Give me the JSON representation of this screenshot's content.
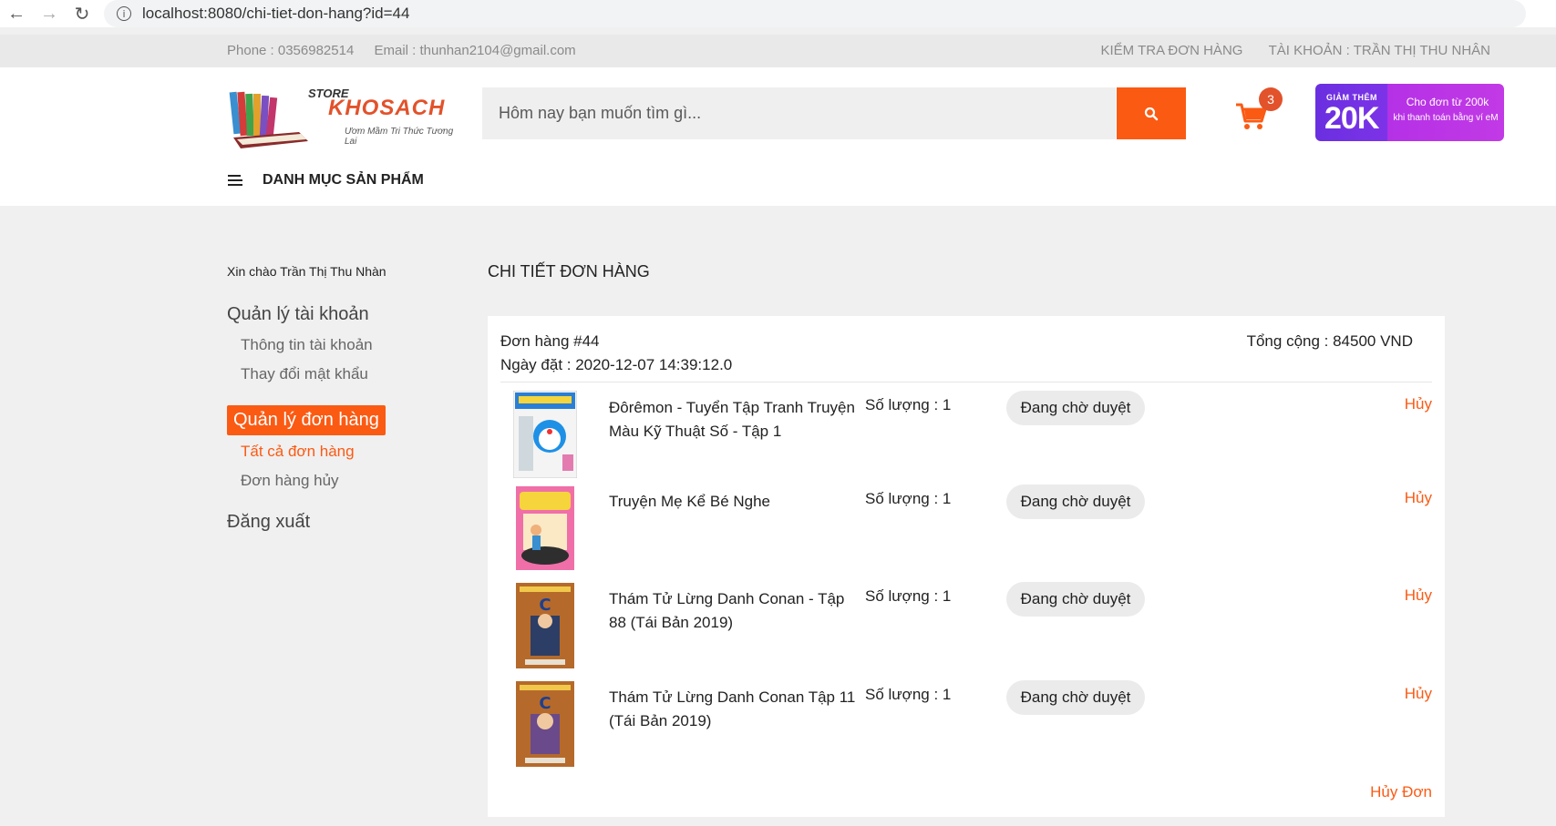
{
  "browser": {
    "url": "localhost:8080/chi-tiet-don-hang?id=44"
  },
  "topbar": {
    "phone": "Phone : 0356982514",
    "email": "Email : thunhan2104@gmail.com",
    "check_order": "KIỂM TRA ĐƠN HÀNG",
    "account": "TÀI KHOẢN : TRẦN THỊ THU NHÂN"
  },
  "header": {
    "logo_store": "STORE",
    "logo_brand": "KHOSACH",
    "logo_slogan": "Ươm Mầm Tri Thức Tương Lai",
    "search_placeholder": "Hôm nay bạn muốn tìm gì...",
    "cart_count": "3",
    "promo": {
      "line1": "GIẢM THÊM",
      "amount": "20K",
      "line2": "Cho đơn từ 200k",
      "line3": "khi thanh toán bằng ví eM"
    },
    "category_menu": "DANH MỤC SẢN PHẨM"
  },
  "sidebar": {
    "greeting": "Xin chào Trần Thị Thu Nhàn",
    "account_mgmt": "Quản lý tài khoản",
    "account_info": "Thông tin tài khoản",
    "change_password": "Thay đổi mật khẩu",
    "order_mgmt": "Quản lý đơn hàng",
    "all_orders": "Tất cả đơn hàng",
    "cancelled_orders": "Đơn hàng hủy",
    "logout": "Đăng xuất"
  },
  "main": {
    "title": "CHI TIẾT ĐƠN HÀNG",
    "order_number": "Đơn hàng #44",
    "order_date": "Ngày đặt : 2020-12-07 14:39:12.0",
    "total": "Tổng cộng : 84500 VND",
    "cancel_order": "Hủy Đơn",
    "items": [
      {
        "name": "Đôrêmon - Tuyển Tập Tranh Truyện Màu Kỹ Thuật Số - Tập 1",
        "qty": "Số lượng : 1",
        "status": "Đang chờ duyệt",
        "cancel": "Hủy"
      },
      {
        "name": "Truyện Mẹ Kể Bé Nghe",
        "qty": "Số lượng : 1",
        "status": "Đang chờ duyệt",
        "cancel": "Hủy"
      },
      {
        "name": "Thám Tử Lừng Danh Conan - Tập 88 (Tái Bản 2019)",
        "qty": "Số lượng : 1",
        "status": "Đang chờ duyệt",
        "cancel": "Hủy"
      },
      {
        "name": "Thám Tử Lừng Danh Conan Tập 11 (Tái Bản 2019)",
        "qty": "Số lượng : 1",
        "status": "Đang chờ duyệt",
        "cancel": "Hủy"
      }
    ]
  },
  "colors": {
    "accent": "#fb5a13",
    "page_bg": "#f0f0f0",
    "strip_bg": "#e9e9e9"
  }
}
